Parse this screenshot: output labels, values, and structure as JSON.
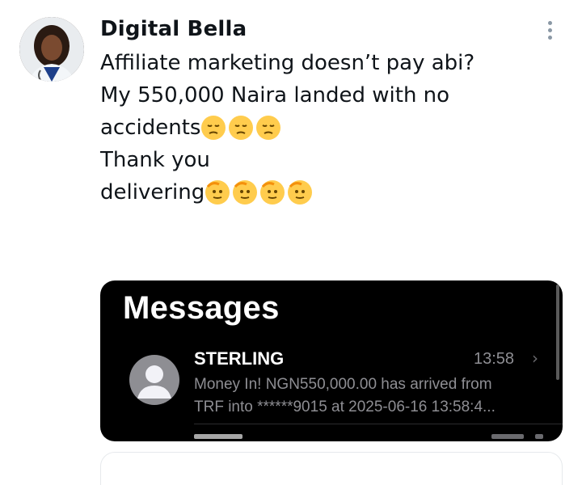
{
  "tweet": {
    "author_name": "Digital Bella",
    "lines": {
      "l1": "Affiliate marketing doesn’t pay abi?",
      "l2": "My 550,000 Naira landed with no",
      "l3": "accidents",
      "l4": "Thank you",
      "l5": "delivering"
    },
    "emojis": {
      "sad": "pensive-face",
      "salute": "saluting-face"
    }
  },
  "screenshot": {
    "title": "Messages",
    "message": {
      "sender": "STERLING",
      "time": "13:58",
      "preview_line1": "Money In! NGN550,000.00 has arrived from",
      "preview_line2": "TRF into ******9015 at 2025-06-16 13:58:4..."
    }
  },
  "colors": {
    "text": "#0f1419",
    "muted_icon": "#8a98a5",
    "media_bg": "#000000",
    "ios_gray": "#8e8e93",
    "emoji_yellow": "#ffcc4d"
  }
}
